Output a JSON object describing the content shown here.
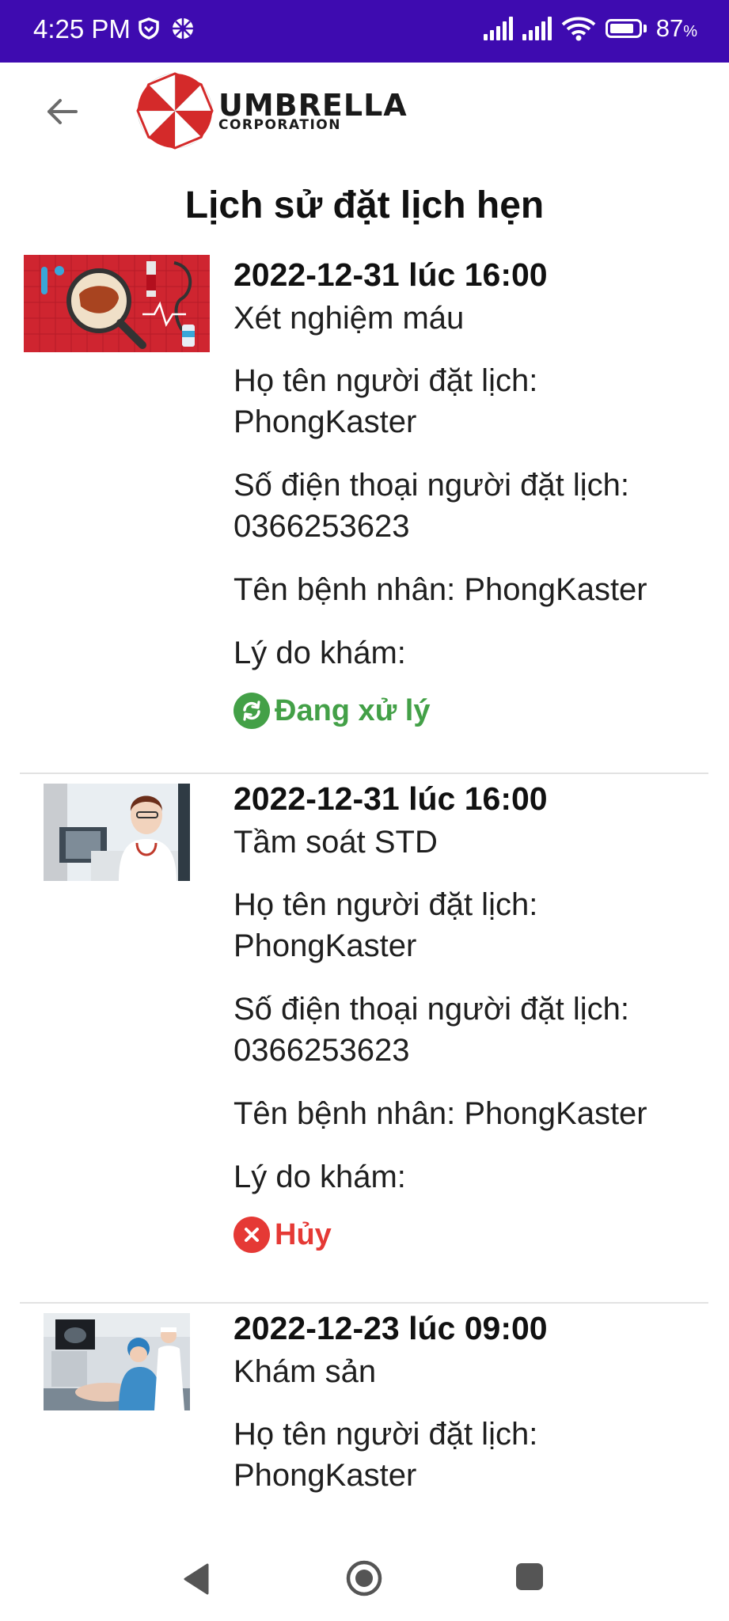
{
  "status_bar": {
    "time": "4:25 PM",
    "battery": "87",
    "battery_unit": "%",
    "icons": [
      "vpn-shield-icon",
      "app-notification-icon",
      "signal-icon",
      "signal-icon",
      "wifi-icon",
      "battery-icon"
    ]
  },
  "header": {
    "back_icon": "arrow-left-icon",
    "logo_main": "UMBRELLA",
    "logo_sub": "CORPORATION"
  },
  "page_title": "Lịch sử đặt lịch hẹn",
  "appointments": [
    {
      "datetime": "2022-12-31 lúc 16:00",
      "service": "Xét nghiệm máu",
      "booker_label": "Họ tên người đặt lịch:",
      "booker_name": "PhongKaster",
      "phone_label": "Số điện thoại người đặt lịch:",
      "phone": "0366253623",
      "patient": "Tên bệnh nhân: PhongKaster",
      "reason": "Lý do khám:",
      "status": "Đang xử lý",
      "status_icon": "refresh-icon",
      "status_color": "#43a047",
      "thumb": "blood-test-illustration"
    },
    {
      "datetime": "2022-12-31 lúc 16:00",
      "service": "Tầm soát STD",
      "booker_label": "Họ tên người đặt lịch:",
      "booker_name": "PhongKaster",
      "phone_label": "Số điện thoại người đặt lịch:",
      "phone": "0366253623",
      "patient": "Tên bệnh nhân: PhongKaster",
      "reason": "Lý do khám:",
      "status": "Hủy",
      "status_icon": "close-icon",
      "status_color": "#e53935",
      "thumb": "doctor-photo"
    },
    {
      "datetime": "2022-12-23 lúc 09:00",
      "service": "Khám sản",
      "booker_label": "Họ tên người đặt lịch:",
      "booker_name": "PhongKaster",
      "thumb": "ultrasound-photo"
    }
  ],
  "nav_bar": {
    "icons": [
      "back-triangle-icon",
      "home-circle-icon",
      "recents-square-icon"
    ]
  }
}
